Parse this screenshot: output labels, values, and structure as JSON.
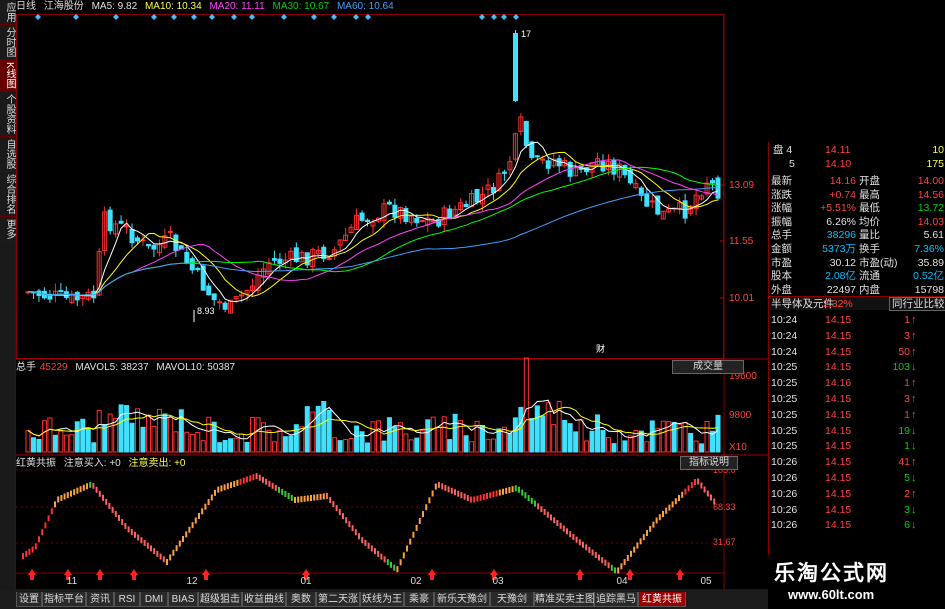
{
  "sidebar": {
    "tabs": [
      {
        "label": "应用",
        "active": false
      },
      {
        "label": "分时图",
        "active": false
      },
      {
        "label": "K线图",
        "active": true
      },
      {
        "label": "个股资料",
        "active": false
      },
      {
        "label": "自选股",
        "active": false
      },
      {
        "label": "综合排名",
        "active": false
      },
      {
        "label": "更多",
        "active": false
      }
    ]
  },
  "header": {
    "period": "日线",
    "stock_name": "江海股份",
    "ma5": "MA5: 9.82",
    "ma10": "MA10: 10.34",
    "ma20": "MA20: 11.11",
    "ma30": "MA30: 10.67",
    "ma60": "MA60: 10.64"
  },
  "price_axis": {
    "labels": [
      "13.09",
      "11.55",
      "10.01"
    ],
    "high_marker": "17",
    "low_marker": "8.93",
    "event_marker": "财"
  },
  "volume": {
    "label": "总手",
    "value": "45229",
    "mavol5": "MAVOL5: 38237",
    "mavol10": "MAVOL10: 50387",
    "button": "成交量",
    "axis": [
      "19600",
      "9800",
      "X10"
    ]
  },
  "indicator": {
    "title": "红黄共振",
    "buy": "注意买入: +0",
    "sell": "注意卖出: +0",
    "button": "指标说明",
    "axis": [
      "105.0",
      "68.33",
      "31.67"
    ]
  },
  "date_axis": [
    "11",
    "12",
    "01",
    "02",
    "03",
    "04",
    "05"
  ],
  "quote": {
    "ask_label": "盘 4",
    "ask_price": "14.11",
    "ask_vol": "10",
    "bid_label": "5",
    "bid_price": "14.10",
    "bid_vol": "175",
    "rows": [
      {
        "l1": "最新",
        "v1": "14.16",
        "l2": "开盘",
        "v2": "14.00"
      },
      {
        "l1": "涨跌",
        "v1": "+0.74",
        "l2": "最高",
        "v2": "14.56"
      },
      {
        "l1": "涨幅",
        "v1": "+5.51%",
        "l2": "最低",
        "v2": "13.72"
      },
      {
        "l1": "振幅",
        "v1": "6.26%",
        "l2": "均价",
        "v2": "14.03"
      },
      {
        "l1": "总手",
        "v1": "38296",
        "l2": "量比",
        "v2": "5.61"
      },
      {
        "l1": "金额",
        "v1": "5373万",
        "l2": "换手",
        "v2": "7.36%"
      },
      {
        "l1": "市盈",
        "v1": "30.12",
        "l2": "市盈(动)",
        "v2": "35.89"
      },
      {
        "l1": "股本",
        "v1": "2.08亿",
        "l2": "流通",
        "v2": "0.52亿"
      },
      {
        "l1": "外盘",
        "v1": "22497",
        "l2": "内盘",
        "v2": "15798"
      }
    ],
    "industry": "半导体及元件",
    "industry_change": "2.32%",
    "industry_button": "同行业比较",
    "ticks": [
      {
        "time": "10:24",
        "price": "14.15",
        "vol": "1",
        "dir": "up"
      },
      {
        "time": "10:24",
        "price": "14.15",
        "vol": "3",
        "dir": "up"
      },
      {
        "time": "10:24",
        "price": "14.15",
        "vol": "50",
        "dir": "up"
      },
      {
        "time": "10:25",
        "price": "14.15",
        "vol": "103",
        "dir": "down"
      },
      {
        "time": "10:25",
        "price": "14.16",
        "vol": "1",
        "dir": "up"
      },
      {
        "time": "10:25",
        "price": "14.15",
        "vol": "3",
        "dir": "up"
      },
      {
        "time": "10:25",
        "price": "14.15",
        "vol": "1",
        "dir": "up"
      },
      {
        "time": "10:25",
        "price": "14.15",
        "vol": "19",
        "dir": "down"
      },
      {
        "time": "10:25",
        "price": "14.15",
        "vol": "1",
        "dir": "down"
      },
      {
        "time": "10:26",
        "price": "14.15",
        "vol": "41",
        "dir": "up"
      },
      {
        "time": "10:26",
        "price": "14.15",
        "vol": "5",
        "dir": "down"
      },
      {
        "time": "10:26",
        "price": "14.15",
        "vol": "2",
        "dir": "up"
      },
      {
        "time": "10:26",
        "price": "14.15",
        "vol": "3",
        "dir": "down"
      },
      {
        "time": "10:26",
        "price": "14.15",
        "vol": "6",
        "dir": "down"
      }
    ]
  },
  "bottom_tabs": [
    {
      "label": "设置",
      "active": false
    },
    {
      "label": "指标平台",
      "active": false
    },
    {
      "label": "资讯",
      "active": false
    },
    {
      "label": "RSI",
      "active": false
    },
    {
      "label": "DMI",
      "active": false
    },
    {
      "label": "BIAS",
      "active": false
    },
    {
      "label": "超级狙击",
      "active": false
    },
    {
      "label": "收益曲线",
      "active": false
    },
    {
      "label": "奥数",
      "active": false
    },
    {
      "label": "第二天涨",
      "active": false
    },
    {
      "label": "妖线为王",
      "active": false
    },
    {
      "label": "乘豪",
      "active": false
    },
    {
      "label": "新乐天豫剑",
      "active": false
    },
    {
      "label": "天豫剑",
      "active": false
    },
    {
      "label": "精准买卖主图",
      "active": false
    },
    {
      "label": "追踪黑马",
      "active": false
    },
    {
      "label": "红黄共振",
      "active": true
    }
  ],
  "brand": {
    "name": "乐淘公式网",
    "url": "www.60lt.com"
  },
  "colors": {
    "up": "#ff3030",
    "down": "#40e0ff",
    "ma5": "#ffffff",
    "ma10": "#ffff00",
    "ma20": "#ff40ff",
    "ma30": "#00ff00",
    "ma60": "#40a0ff"
  }
}
